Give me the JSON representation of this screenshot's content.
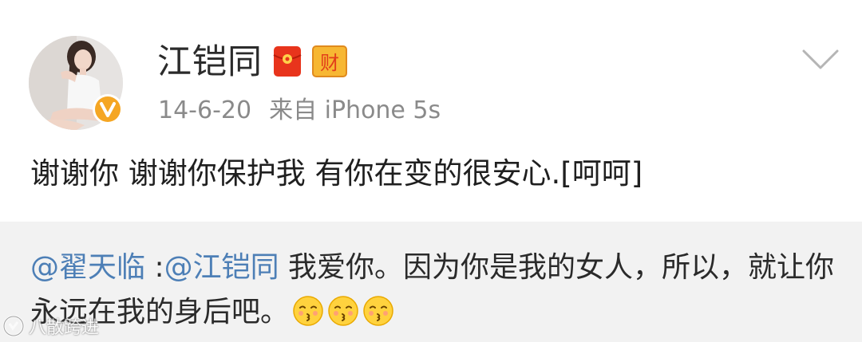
{
  "post": {
    "author": "江铠同",
    "date": "14-6-20",
    "source": "来自 iPhone 5s",
    "text": "谢谢你 谢谢你保护我 有你在变的很安心.[呵呵]",
    "badge_wealth_label": "财"
  },
  "repost": {
    "mention_user": "@翟天临",
    "separator": " :",
    "mention_author": "@江铠同",
    "text": " 我爱你。因为你是我的女人，所以，就让你永远在我的身后吧。",
    "emoji_count": 3,
    "emoji": "kiss-face"
  },
  "watermark": {
    "text": "八散跨进"
  },
  "colors": {
    "mention": "#4d7fb6",
    "verified": "#f5a623",
    "repost_bg": "#f2f2f2"
  },
  "icons": {
    "menu": "chevron-down-icon",
    "verified": "verified-v-icon",
    "redpacket": "red-packet-icon",
    "wealth": "wealth-badge-icon"
  }
}
